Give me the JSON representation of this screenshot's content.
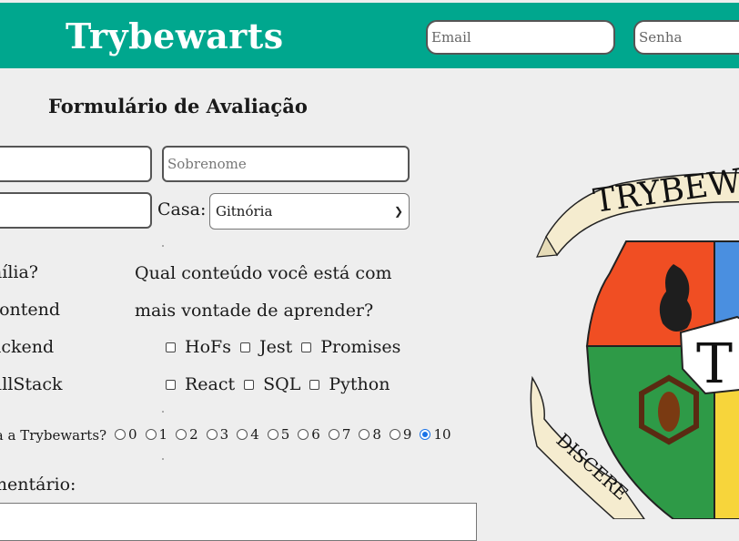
{
  "header": {
    "brand": "Trybewarts",
    "email_placeholder": "Email",
    "password_placeholder": "Senha",
    "background_color": "#00a78e"
  },
  "form": {
    "title": "Formulário de Avaliação",
    "first_name_placeholder": "",
    "last_name_placeholder": "Sobrenome",
    "email_placeholder": "",
    "house_label": "Casa:",
    "house_selected": "Gitnória",
    "family_question": "nília?",
    "family_options": [
      "rontend",
      "ackend",
      "ullStack"
    ],
    "content_question": "Qual conteúdo você está com mais vontade de aprender?",
    "content_options_row1": [
      "HoFs",
      "Jest",
      "Promises"
    ],
    "content_options_row2": [
      "React",
      "SQL",
      "Python"
    ],
    "rating_question": "ia a Trybewarts?",
    "rating_options": [
      "0",
      "1",
      "2",
      "3",
      "4",
      "5",
      "6",
      "7",
      "8",
      "9",
      "10"
    ],
    "rating_selected": "10",
    "comment_label": "mentário:"
  },
  "crest": {
    "banner_text": "TRYBEWA",
    "motto_text": "DISCERE",
    "center_letter": "T",
    "colors": {
      "orange": "#f04e23",
      "blue": "#4a8fe0",
      "green": "#2e9a47",
      "yellow": "#f7d53b",
      "scroll": "#f5eccf"
    }
  }
}
